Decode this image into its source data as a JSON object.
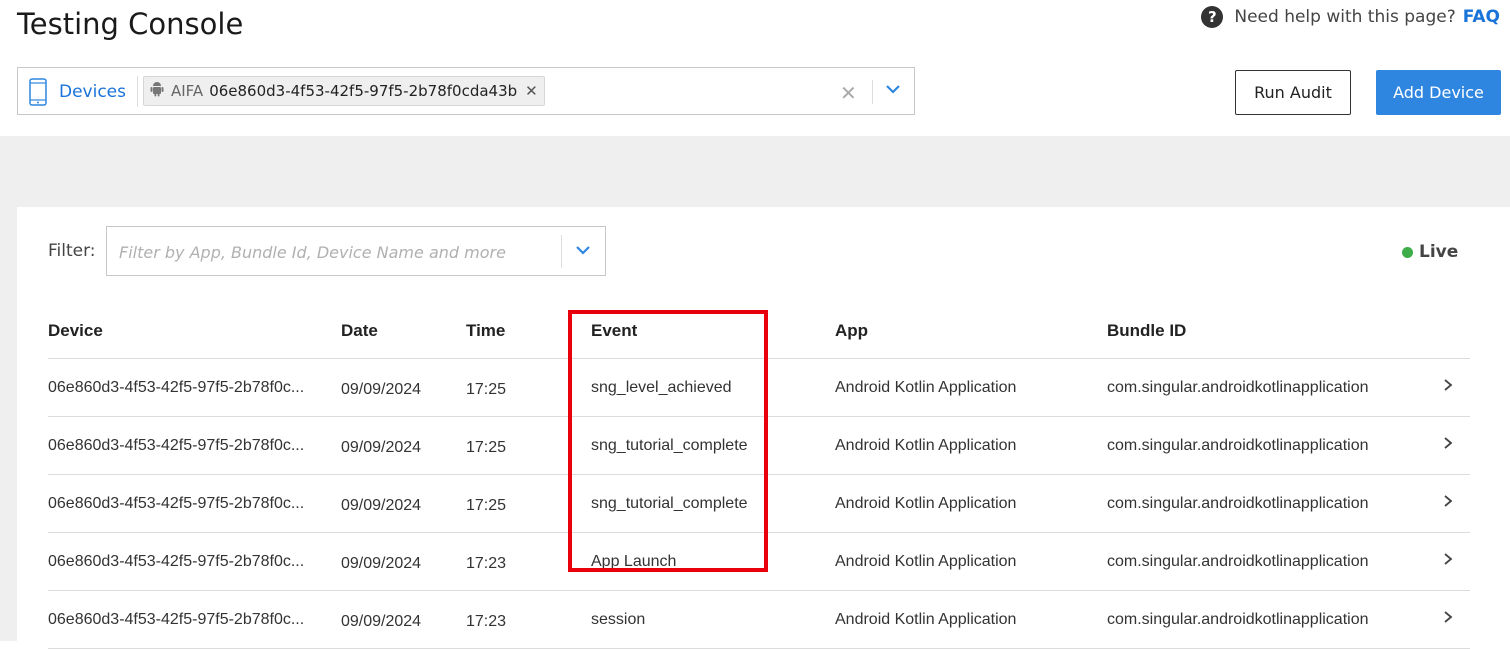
{
  "header": {
    "title": "Testing Console",
    "help_text": "Need help with this page?",
    "faq_label": "FAQ"
  },
  "device_selector": {
    "label": "Devices",
    "chip_type": "AIFA",
    "chip_value": "06e860d3-4f53-42f5-97f5-2b78f0cda43b"
  },
  "actions": {
    "run_audit": "Run Audit",
    "add_device": "Add Device"
  },
  "filter": {
    "label": "Filter:",
    "placeholder": "Filter by App, Bundle Id, Device Name and more"
  },
  "status": {
    "live_label": "Live",
    "live_color": "#3dad4a"
  },
  "table": {
    "columns": [
      "Device",
      "Date",
      "Time",
      "Event",
      "App",
      "Bundle ID"
    ],
    "rows": [
      {
        "device": "06e860d3-4f53-42f5-97f5-2b78f0c...",
        "date": "09/09/2024",
        "time": "17:25",
        "event": "sng_level_achieved",
        "app": "Android Kotlin Application",
        "bundle": "com.singular.androidkotlinapplication"
      },
      {
        "device": "06e860d3-4f53-42f5-97f5-2b78f0c...",
        "date": "09/09/2024",
        "time": "17:25",
        "event": "sng_tutorial_complete",
        "app": "Android Kotlin Application",
        "bundle": "com.singular.androidkotlinapplication"
      },
      {
        "device": "06e860d3-4f53-42f5-97f5-2b78f0c...",
        "date": "09/09/2024",
        "time": "17:25",
        "event": "sng_tutorial_complete",
        "app": "Android Kotlin Application",
        "bundle": "com.singular.androidkotlinapplication"
      },
      {
        "device": "06e860d3-4f53-42f5-97f5-2b78f0c...",
        "date": "09/09/2024",
        "time": "17:23",
        "event": "App Launch",
        "app": "Android Kotlin Application",
        "bundle": "com.singular.androidkotlinapplication"
      },
      {
        "device": "06e860d3-4f53-42f5-97f5-2b78f0c...",
        "date": "09/09/2024",
        "time": "17:23",
        "event": "session",
        "app": "Android Kotlin Application",
        "bundle": "com.singular.androidkotlinapplication"
      }
    ]
  },
  "colors": {
    "accent": "#1a73d9",
    "primary_button": "#2f86e0",
    "highlight_box": "#e8000b",
    "background_band": "#efefef"
  },
  "icons": {
    "help": "question-circle-icon",
    "device": "phone-icon",
    "platform": "android-icon",
    "remove": "close-icon",
    "dropdown": "chevron-down-icon",
    "row_nav": "chevron-right-icon"
  }
}
